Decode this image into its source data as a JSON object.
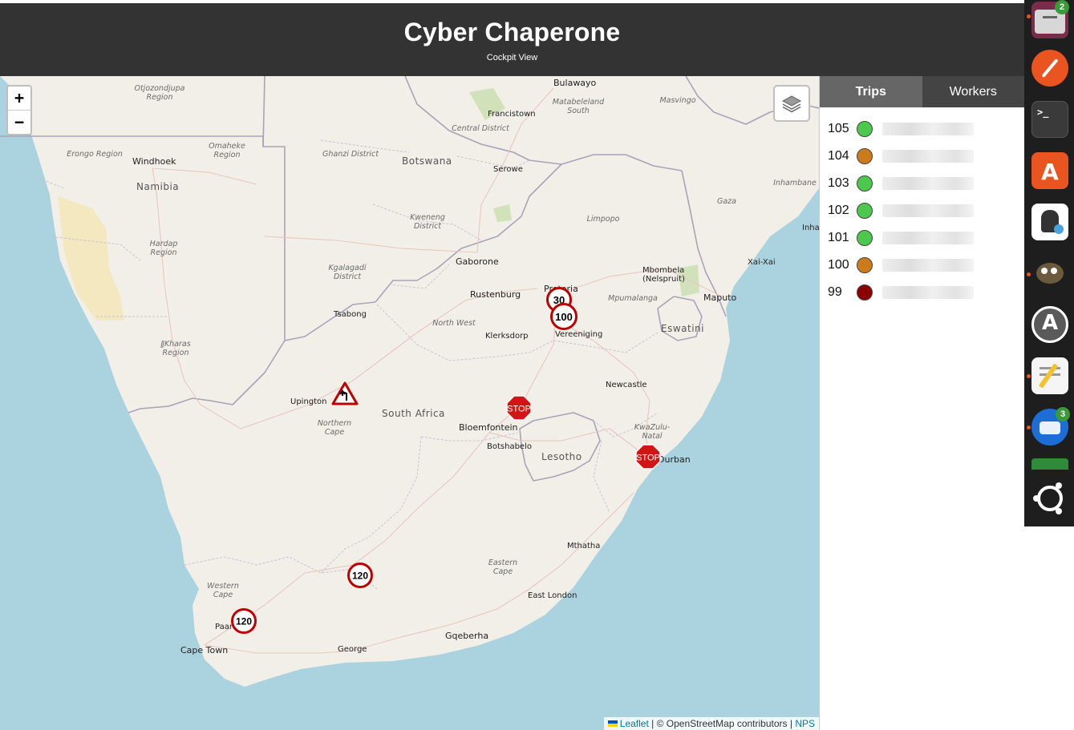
{
  "header": {
    "title": "Cyber Chaperone",
    "subtitle": "Cockpit View"
  },
  "map": {
    "zoom_in": "+",
    "zoom_out": "−",
    "places": {
      "countries": [
        "Botswana",
        "Namibia",
        "South Africa",
        "Lesotho",
        "Eswatini"
      ],
      "cities": [
        "Bulawayo",
        "Francistown",
        "Windhoek",
        "Serowe",
        "Gaborone",
        "Rustenburg",
        "Pretoria",
        "Mbombela (Nelspruit)",
        "Maputo",
        "Xai-Xai",
        "Inha",
        "Tsabong",
        "Klerksdorp",
        "Vereeniging",
        "Newcastle",
        "Upington",
        "Bloemfontein",
        "Botshabelo",
        "Durban",
        "Mthatha",
        "East London",
        "Paarl",
        "Cape Town",
        "George",
        "Gqeberha"
      ],
      "regions": [
        "Otjozondjupa Region",
        "Matabeleland South",
        "Masvingo",
        "Central District",
        "Erongo Region",
        "Omaheke Region",
        "Ghanzi District",
        "Kweneng District",
        "Limpopo",
        "Gaza",
        "Inhambane",
        "Hardap Region",
        "Kgalagadi District",
        "North West",
        "Mpumalanga",
        "ǁKharas Region",
        "Northern Cape",
        "KwaZulu-Natal",
        "Eastern Cape",
        "Western Cape"
      ]
    },
    "signs": [
      {
        "kind": "speed-limit",
        "label": "30"
      },
      {
        "kind": "speed-limit",
        "label": "100"
      },
      {
        "kind": "warning-curve",
        "label": ""
      },
      {
        "kind": "stop",
        "label": "STOP"
      },
      {
        "kind": "stop",
        "label": "STOP"
      },
      {
        "kind": "speed-limit",
        "label": "120"
      },
      {
        "kind": "speed-limit",
        "label": "120"
      }
    ],
    "attribution": {
      "leaflet": "Leaflet",
      "sep": " | © OpenStreetMap contributors | ",
      "nps": "NPS"
    }
  },
  "sidebar": {
    "tabs": [
      {
        "label": "Trips",
        "active": true
      },
      {
        "label": "Workers",
        "active": false
      }
    ],
    "trips": [
      {
        "id": "105",
        "status_color": "#4cc94c"
      },
      {
        "id": "104",
        "status_color": "#cc7a1a"
      },
      {
        "id": "103",
        "status_color": "#4cc94c"
      },
      {
        "id": "102",
        "status_color": "#4cc94c"
      },
      {
        "id": "101",
        "status_color": "#4cc94c"
      },
      {
        "id": "100",
        "status_color": "#cc7a1a"
      },
      {
        "id": "99",
        "status_color": "#8b0000"
      }
    ]
  },
  "dock": {
    "items": [
      "files-icon",
      "pen-app-icon",
      "terminal-icon",
      "app-center-icon",
      "reader-icon",
      "gimp-icon",
      "software-updater-icon",
      "text-editor-icon",
      "thunderbird-icon",
      "green-app-icon",
      "ubuntu-logo-icon"
    ],
    "files_badge": "2",
    "thunderbird_badge": "3"
  }
}
